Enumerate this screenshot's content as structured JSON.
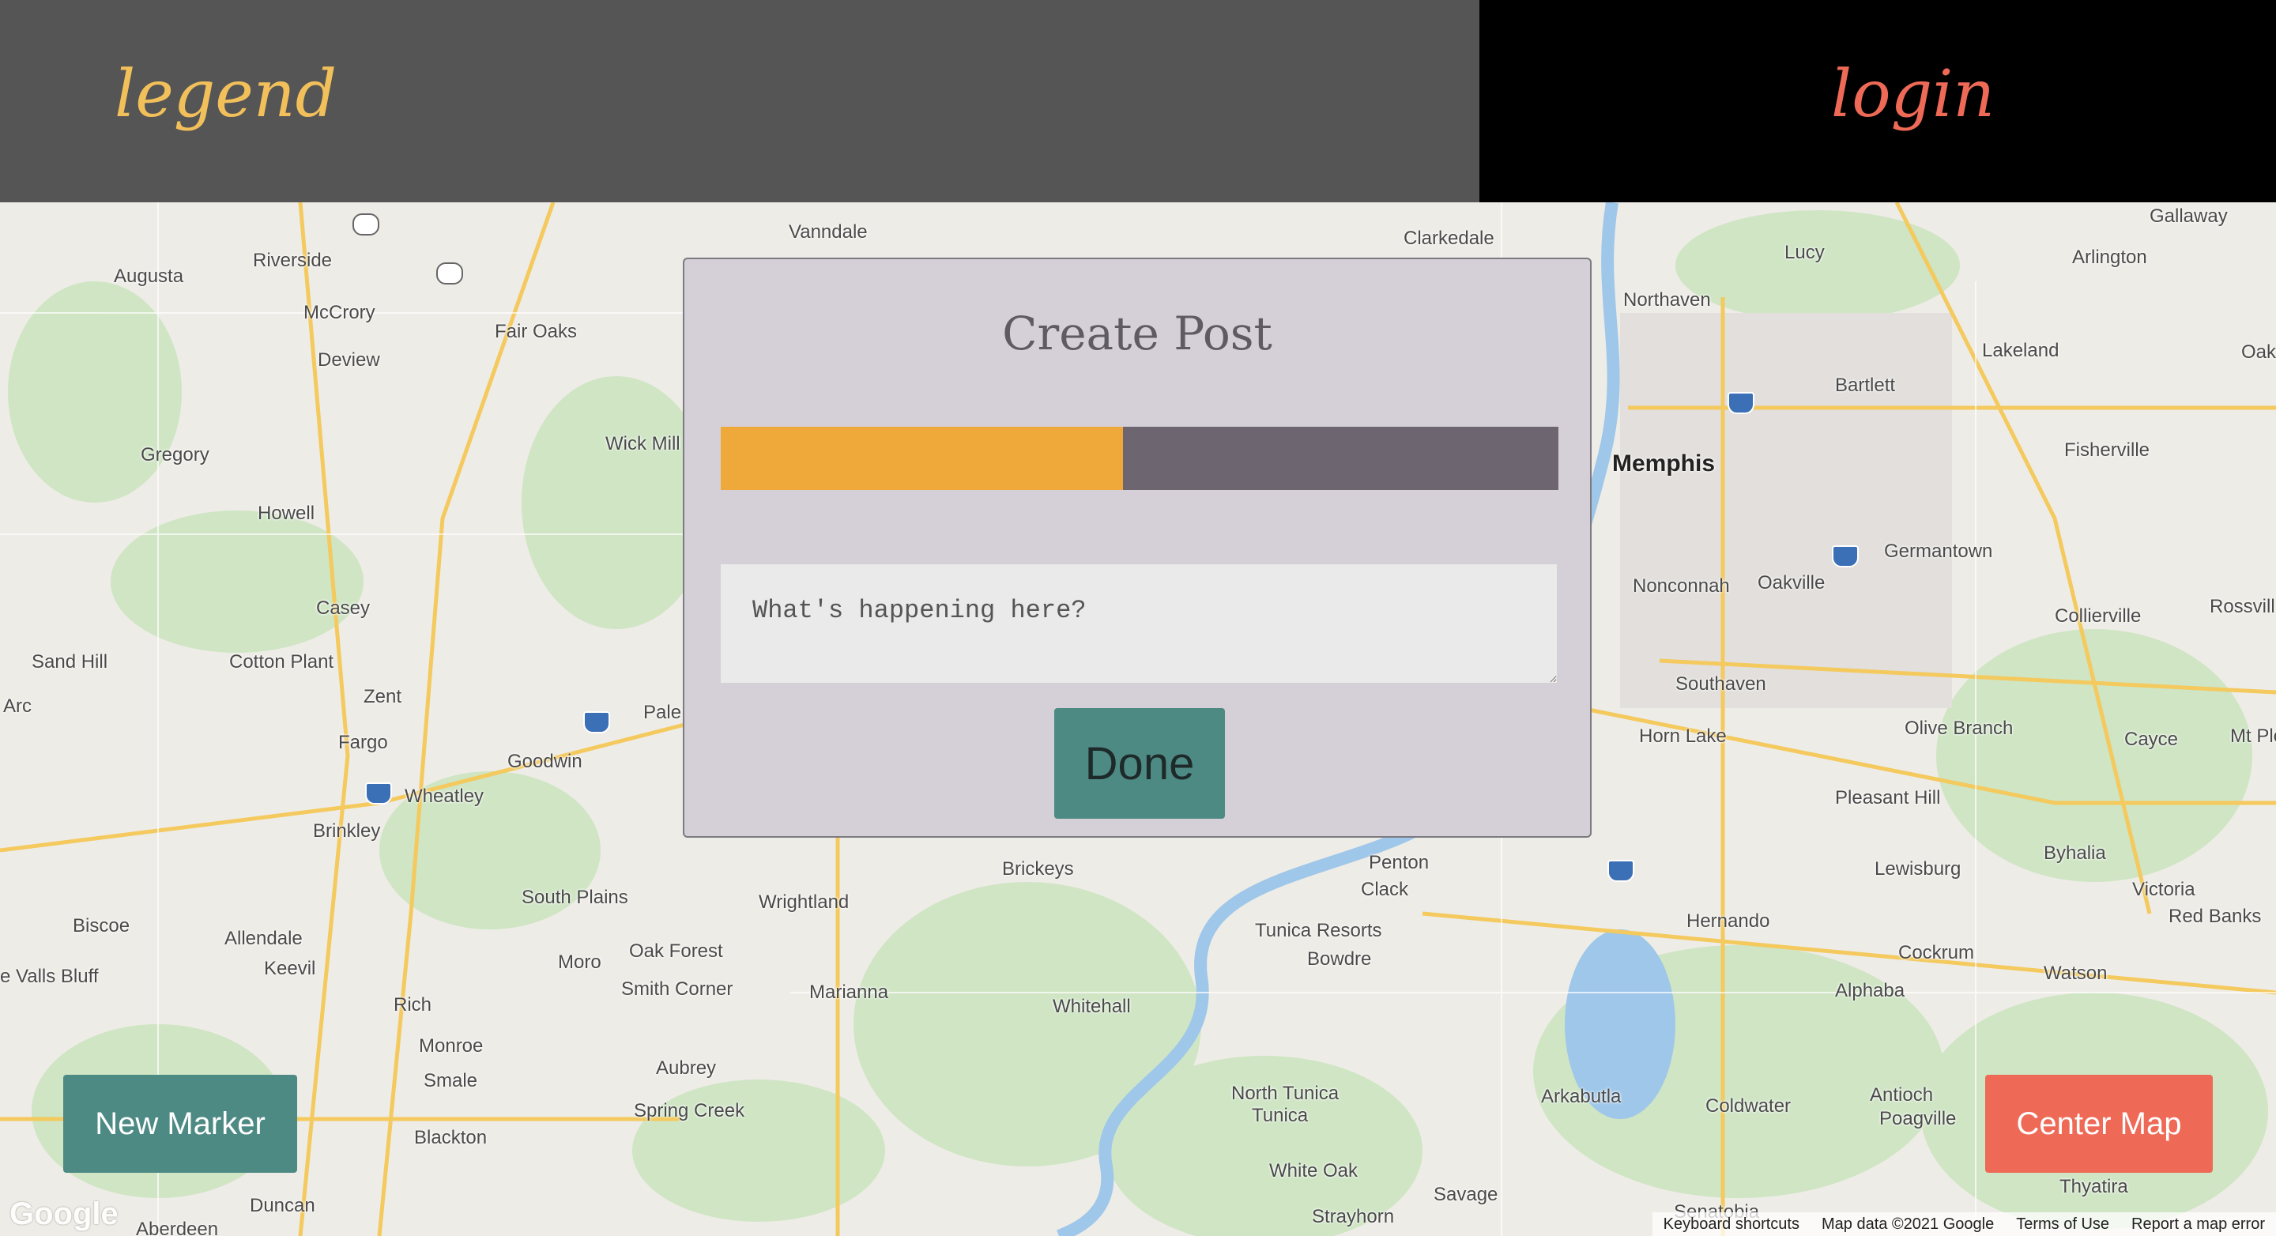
{
  "header": {
    "legend_label": "legend",
    "login_label": "login"
  },
  "modal": {
    "title": "Create Post",
    "progress_fraction": 0.48,
    "input_placeholder": "What's happening here?",
    "done_label": "Done"
  },
  "buttons": {
    "new_marker": "New Marker",
    "center_map": "Center Map"
  },
  "map": {
    "places": [
      "Memphis",
      "Riverside",
      "Augusta",
      "McCrory",
      "Deview",
      "Fair Oaks",
      "Vanndale",
      "Clarkedale",
      "Lucy",
      "Gallaway",
      "Northaven",
      "Arlington",
      "Lakeland",
      "Bartlett",
      "Fisherville",
      "Gregory",
      "Howell",
      "Wick Mill",
      "Casey",
      "Sand Hill",
      "Cotton Plant",
      "Zent",
      "Arc",
      "Fargo",
      "Goodwin",
      "Wheatley",
      "Brinkley",
      "Pale",
      "Germantown",
      "Nonconnah",
      "Oakville",
      "Collierville",
      "Rossvill",
      "Southaven",
      "Horn Lake",
      "Olive Branch",
      "Cayce",
      "Mt Ple",
      "Pleasant Hill",
      "Byhalia",
      "Victoria",
      "Red Banks",
      "Lewisburg",
      "Hernando",
      "Cockrum",
      "Watson",
      "Alphaba",
      "Penton",
      "Clack",
      "Tunica Resorts",
      "Bowdre",
      "Brickeys",
      "Wrightland",
      "Oak Forest",
      "Smith Corner",
      "Marianna",
      "Whitehall",
      "Moro",
      "South Plains",
      "Allendale",
      "Biscoe",
      "Keevil",
      "e Valls Bluff",
      "Rich",
      "Monroe",
      "Smale",
      "Blackton",
      "Aubrey",
      "Spring Creek",
      "Duncan",
      "Aberdeen",
      "North Tunica",
      "Tunica",
      "White Oak",
      "Savage",
      "Strayhorn",
      "Arkabutla",
      "Coldwater",
      "Antioch",
      "Poagville",
      "Thyatira",
      "Senatobia",
      "Oak"
    ],
    "logo": "Google",
    "footer": {
      "shortcuts": "Keyboard shortcuts",
      "map_data": "Map data ©2021 Google",
      "terms": "Terms of Use",
      "report": "Report a map error"
    }
  }
}
